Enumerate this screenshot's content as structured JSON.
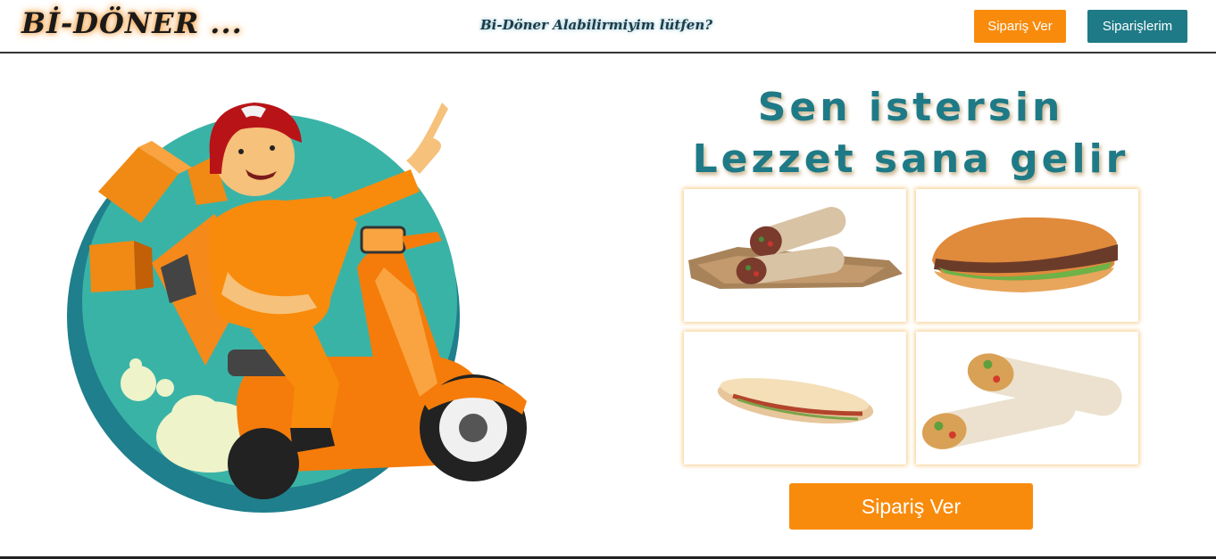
{
  "header": {
    "logo": "Bİ-DÖNER ...",
    "tagline": "Bi-Döner Alabilirmiyim lütfen?",
    "order_button": "Sipariş Ver",
    "my_orders_button": "Siparişlerim"
  },
  "hero": {
    "headline_line1": "Sen istersin",
    "headline_line2": "Lezzet sana gelir",
    "order_button": "Sipariş Ver",
    "illustration": "delivery-scooter-illustration",
    "food_images": [
      "doner-wrap",
      "doner-sandwich",
      "flatbread-sandwich",
      "chicken-wrap"
    ]
  },
  "colors": {
    "accent_orange": "#f98b0c",
    "teal": "#1e7a86"
  }
}
